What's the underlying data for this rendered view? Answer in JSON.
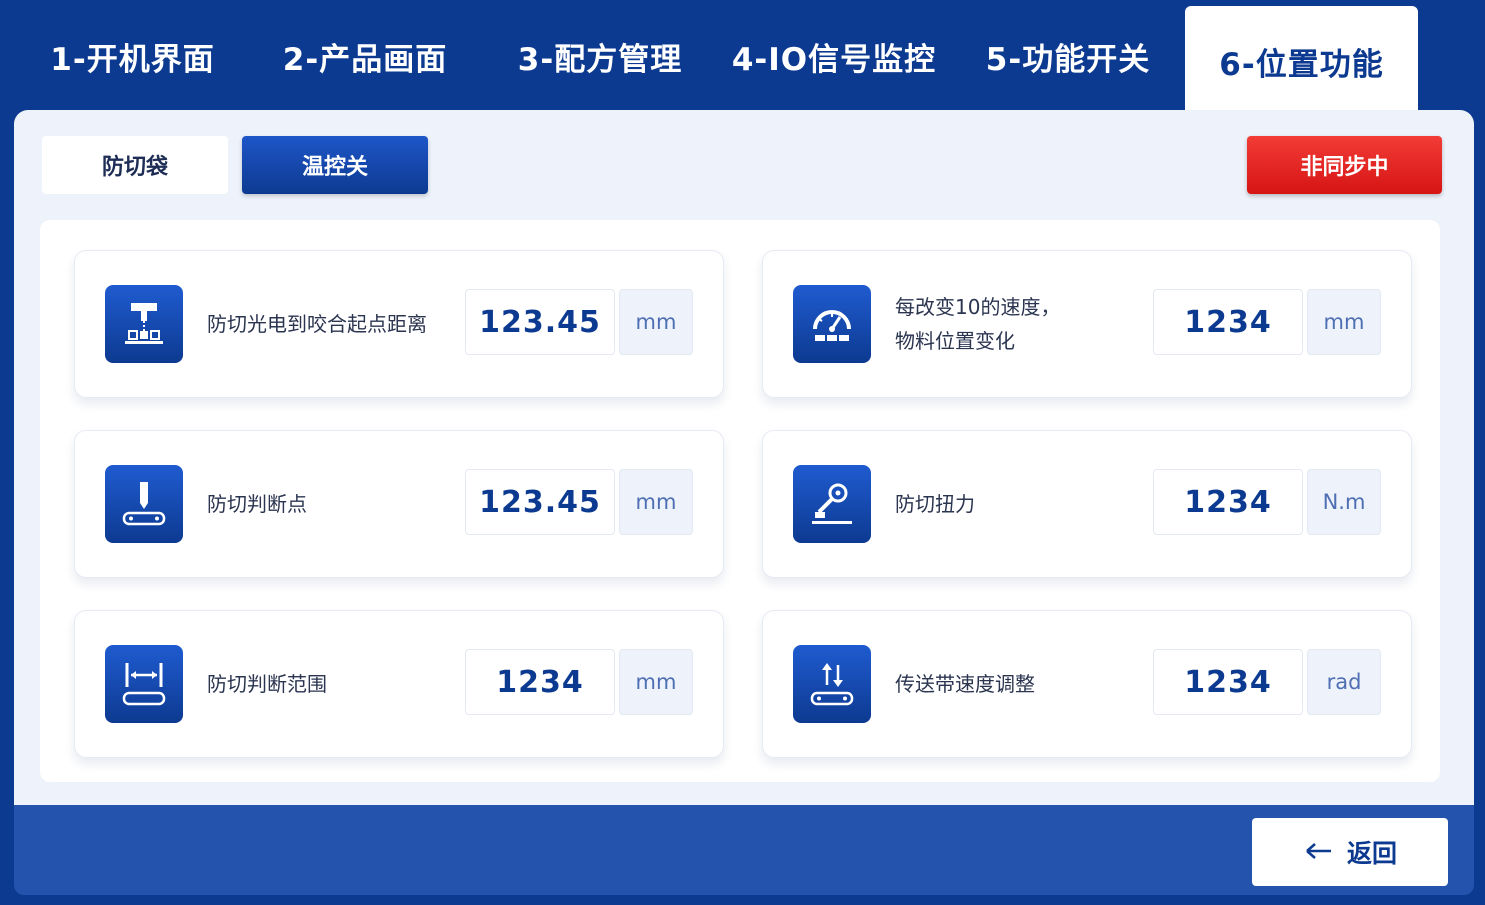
{
  "tabs": [
    {
      "label": "1-开机界面"
    },
    {
      "label": "2-产品画面"
    },
    {
      "label": "3-配方管理"
    },
    {
      "label": "4-IO信号监控"
    },
    {
      "label": "5-功能开关"
    },
    {
      "label": "6-位置功能",
      "active": true
    }
  ],
  "subtabs": {
    "anti_cut_bag": "防切袋",
    "temp_control_off": "温控关"
  },
  "status": {
    "sync": "非同步中"
  },
  "params": [
    {
      "label": "防切光电到咬合起点距离",
      "value": "123.45",
      "unit": "mm",
      "icon": "photoelectric-sensor-icon"
    },
    {
      "label": "每改变10的速度，\n物料位置变化",
      "value": "1234",
      "unit": "mm",
      "icon": "speed-gauge-icon"
    },
    {
      "label": "防切判断点",
      "value": "123.45",
      "unit": "mm",
      "icon": "cutter-point-icon"
    },
    {
      "label": "防切扭力",
      "value": "1234",
      "unit": "N.m",
      "icon": "torque-wrench-icon"
    },
    {
      "label": "防切判断范围",
      "value": "1234",
      "unit": "mm",
      "icon": "range-width-icon"
    },
    {
      "label": "传送带速度调整",
      "value": "1234",
      "unit": "rad",
      "icon": "conveyor-speed-icon"
    }
  ],
  "footer": {
    "back_label": "返回",
    "back_icon": "arrow-left-icon"
  },
  "colors": {
    "primary": "#0d3a91",
    "accent": "#1f5bd0",
    "alert": "#e02020",
    "panel": "#eef2fa"
  }
}
